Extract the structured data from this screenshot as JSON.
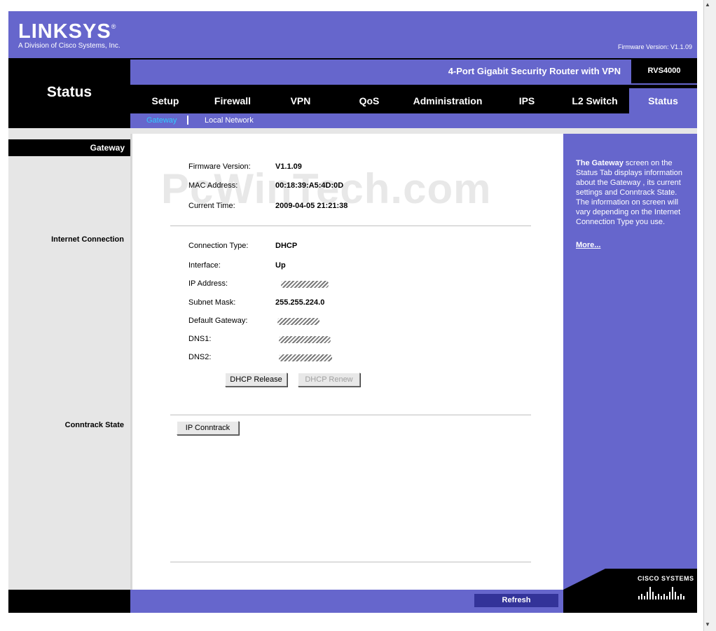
{
  "header": {
    "brand": "LINKSYS",
    "brand_mark": "®",
    "brand_subtitle": "A Division of Cisco Systems, Inc.",
    "firmware_top": "Firmware Version: V1.1.09",
    "section_title": "Status",
    "product_name": "4-Port Gigabit Security Router with VPN",
    "model": "RVS4000"
  },
  "tabs": [
    {
      "label": "Setup"
    },
    {
      "label": "Firewall"
    },
    {
      "label": "VPN"
    },
    {
      "label": "QoS"
    },
    {
      "label": "Administration"
    },
    {
      "label": "IPS"
    },
    {
      "label": "L2 Switch"
    },
    {
      "label": "Status",
      "active": true
    }
  ],
  "subtabs": [
    {
      "label": "Gateway",
      "active": true
    },
    {
      "label": "Local Network"
    }
  ],
  "left": {
    "gateway": "Gateway",
    "internet_connection": "Internet Connection",
    "conntrack_state": "Conntrack State"
  },
  "info": {
    "firmware_label": "Firmware Version:",
    "firmware_value": "V1.1.09",
    "mac_label": "MAC Address:",
    "mac_value": "00:18:39:A5:4D:0D",
    "time_label": "Current Time:",
    "time_value": "2009-04-05 21:21:38"
  },
  "connection": {
    "type_label": "Connection Type:",
    "type_value": "DHCP",
    "interface_label": "Interface:",
    "interface_value": "Up",
    "ip_label": "IP Address:",
    "subnet_label": "Subnet Mask:",
    "subnet_value": "255.255.224.0",
    "gateway_label": "Default Gateway:",
    "dns1_label": "DNS1:",
    "dns2_label": "DNS2:",
    "dhcp_release": "DHCP Release",
    "dhcp_renew": "DHCP Renew"
  },
  "conntrack": {
    "button": "IP Conntrack"
  },
  "help": {
    "bold": "The Gateway",
    "text": " screen on the Status Tab displays information about the Gateway , its current settings and Conntrack State. The information on screen will vary depending on the Internet Connection Type you use.",
    "more": "More..."
  },
  "footer": {
    "refresh": "Refresh",
    "cisco": "CISCO SYSTEMS"
  },
  "watermark": "PcWinTech.com",
  "colors": {
    "purple": "#6666cc",
    "black": "#000000",
    "gray": "#e6e6e6",
    "subtab_active": "#33ccff",
    "refresh_bg": "#333399"
  }
}
